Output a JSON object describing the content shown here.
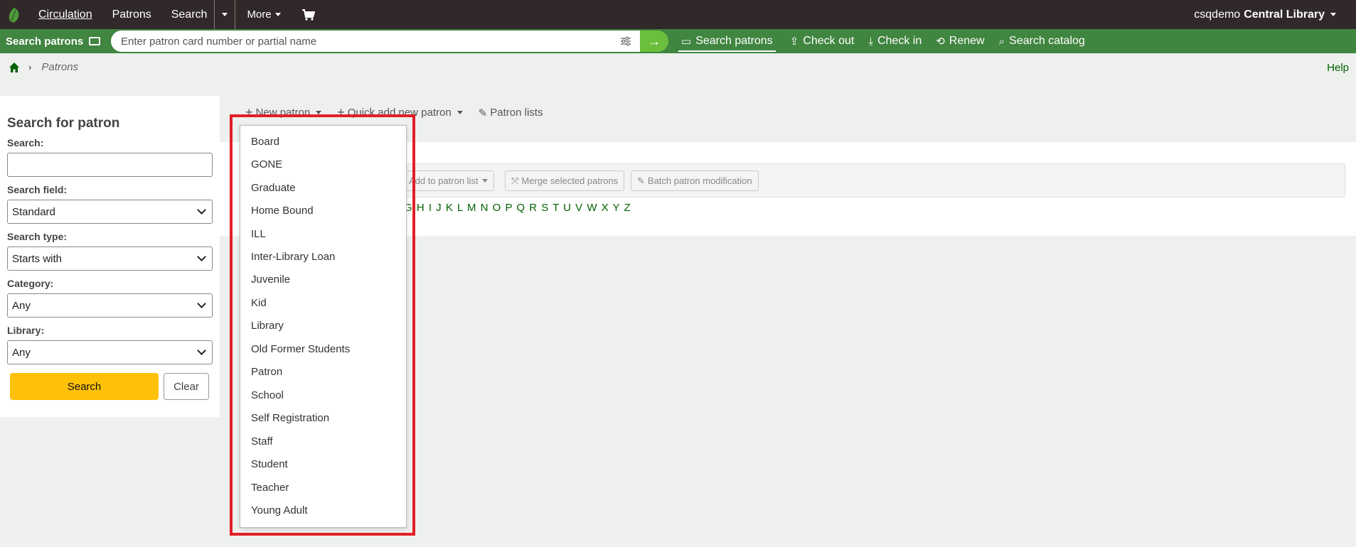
{
  "topnav": {
    "items": [
      "Circulation",
      "Patrons",
      "Search"
    ],
    "more_label": "More",
    "user": "csqdemo",
    "library": "Central Library"
  },
  "searchbar": {
    "label": "Search patrons",
    "placeholder": "Enter patron card number or partial name",
    "links": [
      "Search patrons",
      "Check out",
      "Check in",
      "Renew",
      "Search catalog"
    ]
  },
  "breadcrumb": {
    "current": "Patrons"
  },
  "help_label": "Help",
  "left": {
    "title": "Search for patron",
    "search_label": "Search:",
    "search_value": "",
    "field_label": "Search field:",
    "field_value": "Standard",
    "type_label": "Search type:",
    "type_value": "Starts with",
    "category_label": "Category:",
    "category_value": "Any",
    "library_label": "Library:",
    "library_value": "Any",
    "search_button": "Search",
    "clear_button": "Clear"
  },
  "toolbar": {
    "new_patron": "New patron",
    "quick_add": "Quick add new patron",
    "patron_lists": "Patron lists"
  },
  "actions": {
    "add_to_list": "Add to patron list",
    "merge": "Merge selected patrons",
    "batch": "Batch patron modification"
  },
  "alphabet": "G H I J K L M N O P Q R S T U V W X Y Z",
  "dropdown": {
    "items": [
      "Board",
      "GONE",
      "Graduate",
      "Home Bound",
      "ILL",
      "Inter-Library Loan",
      "Juvenile",
      "Kid",
      "Library",
      "Old Former Students",
      "Patron",
      "School",
      "Self Registration",
      "Staff",
      "Student",
      "Teacher",
      "Young Adult"
    ]
  }
}
